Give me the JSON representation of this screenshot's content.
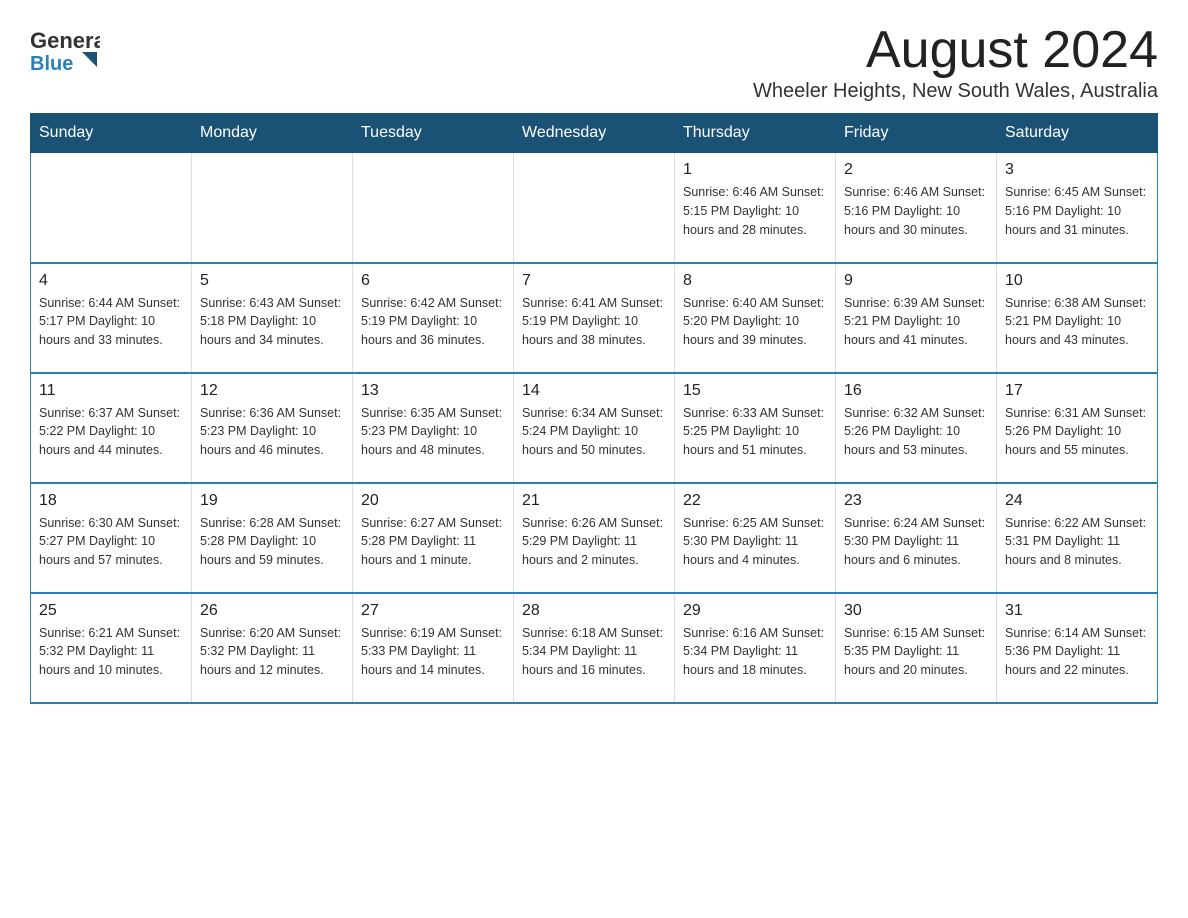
{
  "header": {
    "logo_general": "General",
    "logo_blue": "Blue",
    "month_title": "August 2024",
    "location": "Wheeler Heights, New South Wales, Australia"
  },
  "days_of_week": [
    "Sunday",
    "Monday",
    "Tuesday",
    "Wednesday",
    "Thursday",
    "Friday",
    "Saturday"
  ],
  "weeks": [
    [
      {
        "day": "",
        "info": ""
      },
      {
        "day": "",
        "info": ""
      },
      {
        "day": "",
        "info": ""
      },
      {
        "day": "",
        "info": ""
      },
      {
        "day": "1",
        "info": "Sunrise: 6:46 AM\nSunset: 5:15 PM\nDaylight: 10 hours and 28 minutes."
      },
      {
        "day": "2",
        "info": "Sunrise: 6:46 AM\nSunset: 5:16 PM\nDaylight: 10 hours and 30 minutes."
      },
      {
        "day": "3",
        "info": "Sunrise: 6:45 AM\nSunset: 5:16 PM\nDaylight: 10 hours and 31 minutes."
      }
    ],
    [
      {
        "day": "4",
        "info": "Sunrise: 6:44 AM\nSunset: 5:17 PM\nDaylight: 10 hours and 33 minutes."
      },
      {
        "day": "5",
        "info": "Sunrise: 6:43 AM\nSunset: 5:18 PM\nDaylight: 10 hours and 34 minutes."
      },
      {
        "day": "6",
        "info": "Sunrise: 6:42 AM\nSunset: 5:19 PM\nDaylight: 10 hours and 36 minutes."
      },
      {
        "day": "7",
        "info": "Sunrise: 6:41 AM\nSunset: 5:19 PM\nDaylight: 10 hours and 38 minutes."
      },
      {
        "day": "8",
        "info": "Sunrise: 6:40 AM\nSunset: 5:20 PM\nDaylight: 10 hours and 39 minutes."
      },
      {
        "day": "9",
        "info": "Sunrise: 6:39 AM\nSunset: 5:21 PM\nDaylight: 10 hours and 41 minutes."
      },
      {
        "day": "10",
        "info": "Sunrise: 6:38 AM\nSunset: 5:21 PM\nDaylight: 10 hours and 43 minutes."
      }
    ],
    [
      {
        "day": "11",
        "info": "Sunrise: 6:37 AM\nSunset: 5:22 PM\nDaylight: 10 hours and 44 minutes."
      },
      {
        "day": "12",
        "info": "Sunrise: 6:36 AM\nSunset: 5:23 PM\nDaylight: 10 hours and 46 minutes."
      },
      {
        "day": "13",
        "info": "Sunrise: 6:35 AM\nSunset: 5:23 PM\nDaylight: 10 hours and 48 minutes."
      },
      {
        "day": "14",
        "info": "Sunrise: 6:34 AM\nSunset: 5:24 PM\nDaylight: 10 hours and 50 minutes."
      },
      {
        "day": "15",
        "info": "Sunrise: 6:33 AM\nSunset: 5:25 PM\nDaylight: 10 hours and 51 minutes."
      },
      {
        "day": "16",
        "info": "Sunrise: 6:32 AM\nSunset: 5:26 PM\nDaylight: 10 hours and 53 minutes."
      },
      {
        "day": "17",
        "info": "Sunrise: 6:31 AM\nSunset: 5:26 PM\nDaylight: 10 hours and 55 minutes."
      }
    ],
    [
      {
        "day": "18",
        "info": "Sunrise: 6:30 AM\nSunset: 5:27 PM\nDaylight: 10 hours and 57 minutes."
      },
      {
        "day": "19",
        "info": "Sunrise: 6:28 AM\nSunset: 5:28 PM\nDaylight: 10 hours and 59 minutes."
      },
      {
        "day": "20",
        "info": "Sunrise: 6:27 AM\nSunset: 5:28 PM\nDaylight: 11 hours and 1 minute."
      },
      {
        "day": "21",
        "info": "Sunrise: 6:26 AM\nSunset: 5:29 PM\nDaylight: 11 hours and 2 minutes."
      },
      {
        "day": "22",
        "info": "Sunrise: 6:25 AM\nSunset: 5:30 PM\nDaylight: 11 hours and 4 minutes."
      },
      {
        "day": "23",
        "info": "Sunrise: 6:24 AM\nSunset: 5:30 PM\nDaylight: 11 hours and 6 minutes."
      },
      {
        "day": "24",
        "info": "Sunrise: 6:22 AM\nSunset: 5:31 PM\nDaylight: 11 hours and 8 minutes."
      }
    ],
    [
      {
        "day": "25",
        "info": "Sunrise: 6:21 AM\nSunset: 5:32 PM\nDaylight: 11 hours and 10 minutes."
      },
      {
        "day": "26",
        "info": "Sunrise: 6:20 AM\nSunset: 5:32 PM\nDaylight: 11 hours and 12 minutes."
      },
      {
        "day": "27",
        "info": "Sunrise: 6:19 AM\nSunset: 5:33 PM\nDaylight: 11 hours and 14 minutes."
      },
      {
        "day": "28",
        "info": "Sunrise: 6:18 AM\nSunset: 5:34 PM\nDaylight: 11 hours and 16 minutes."
      },
      {
        "day": "29",
        "info": "Sunrise: 6:16 AM\nSunset: 5:34 PM\nDaylight: 11 hours and 18 minutes."
      },
      {
        "day": "30",
        "info": "Sunrise: 6:15 AM\nSunset: 5:35 PM\nDaylight: 11 hours and 20 minutes."
      },
      {
        "day": "31",
        "info": "Sunrise: 6:14 AM\nSunset: 5:36 PM\nDaylight: 11 hours and 22 minutes."
      }
    ]
  ]
}
